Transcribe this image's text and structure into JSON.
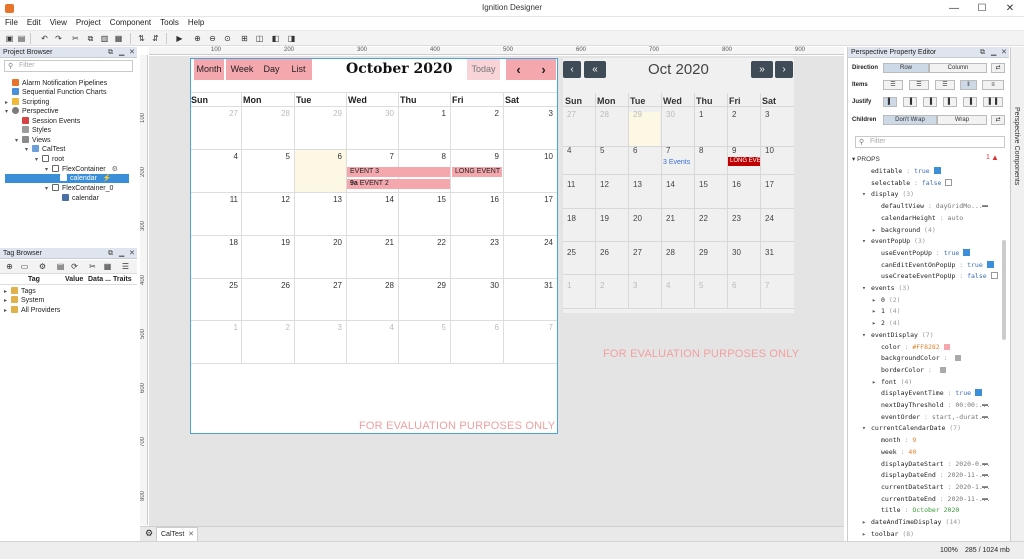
{
  "window": {
    "title": "Ignition Designer",
    "minimize": "—",
    "maximize": "☐",
    "close": "✕"
  },
  "menu": [
    "File",
    "Edit",
    "View",
    "Project",
    "Component",
    "Tools",
    "Help"
  ],
  "project_browser": {
    "title": "Project Browser",
    "filter_placeholder": "Filter",
    "items": [
      "Alarm Notification Pipelines",
      "Sequential Function Charts",
      "Scripting",
      "Perspective",
      "Session Events",
      "Styles",
      "Views",
      "CalTest",
      "root",
      "FlexContainer",
      "calendar",
      "FlexContainer_0",
      "calendar"
    ]
  },
  "tag_browser": {
    "title": "Tag Browser",
    "columns": [
      "Tag",
      "Value",
      "Data ...",
      "Traits"
    ],
    "items": [
      "Tags",
      "System",
      "All Providers"
    ]
  },
  "calendar1": {
    "buttons": {
      "month": "Month",
      "week": "Week",
      "day": "Day",
      "list": "List",
      "today": "Today",
      "prev": "‹",
      "next": "›"
    },
    "title": "October 2020",
    "days": [
      "Sun",
      "Mon",
      "Tue",
      "Wed",
      "Thu",
      "Fri",
      "Sat"
    ],
    "weeks": [
      [
        "27",
        "28",
        "29",
        "30",
        "1",
        "2",
        "3"
      ],
      [
        "4",
        "5",
        "6",
        "7",
        "8",
        "9",
        "10"
      ],
      [
        "11",
        "12",
        "13",
        "14",
        "15",
        "16",
        "17"
      ],
      [
        "18",
        "19",
        "20",
        "21",
        "22",
        "23",
        "24"
      ],
      [
        "25",
        "26",
        "27",
        "28",
        "29",
        "30",
        "31"
      ],
      [
        "1",
        "2",
        "3",
        "4",
        "5",
        "6",
        "7"
      ]
    ],
    "events": {
      "e3": "EVENT 3",
      "e2_time": "9a",
      "e2": "EVENT 2",
      "long": "LONG EVENT N"
    },
    "watermark": "FOR EVALUATION PURPOSES ONLY"
  },
  "calendar2": {
    "title": "Oct 2020",
    "buttons": {
      "prev_year": "‹",
      "prev": "«",
      "next": "»",
      "next_year": "›"
    },
    "days": [
      "Sun",
      "Mon",
      "Tue",
      "Wed",
      "Thu",
      "Fri",
      "Sat"
    ],
    "weeks": [
      [
        "27",
        "28",
        "29",
        "30",
        "1",
        "2",
        "3"
      ],
      [
        "4",
        "5",
        "6",
        "7",
        "8",
        "9",
        "10"
      ],
      [
        "11",
        "12",
        "13",
        "14",
        "15",
        "16",
        "17"
      ],
      [
        "18",
        "19",
        "20",
        "21",
        "22",
        "23",
        "24"
      ],
      [
        "25",
        "26",
        "27",
        "28",
        "29",
        "30",
        "31"
      ],
      [
        "1",
        "2",
        "3",
        "4",
        "5",
        "6",
        "7"
      ]
    ],
    "events_link": "3 Events",
    "long_event": "LONG EVEN",
    "watermark": "FOR EVALUATION PURPOSES ONLY"
  },
  "tab": {
    "label": "CalTest"
  },
  "status": {
    "zoom": "100%",
    "memory": "285 / 1024 mb"
  },
  "property_editor": {
    "title": "Perspective Property Editor",
    "side_tab": "Perspective Components",
    "labels": {
      "direction": "Direction",
      "items": "Items",
      "justify": "Justify",
      "children": "Children"
    },
    "direction": [
      "Row",
      "Column"
    ],
    "children": [
      "Don't Wrap",
      "Wrap"
    ],
    "filter_placeholder": "Filter",
    "props_header": "PROPS",
    "warning_count": "1",
    "rows": [
      {
        "k": "editable",
        "v": "true"
      },
      {
        "k": "selectable",
        "v": "false"
      },
      {
        "k": "display",
        "c": "(3)"
      },
      {
        "k": "defaultView",
        "v": "dayGridMo..."
      },
      {
        "k": "calendarHeight",
        "v": "auto"
      },
      {
        "k": "background",
        "c": "(4)"
      },
      {
        "k": "eventPopUp",
        "c": "(3)"
      },
      {
        "k": "useEventPopUp",
        "v": "true"
      },
      {
        "k": "canEditEventOnPopUp",
        "v": "true"
      },
      {
        "k": "useCreateEventPopUp",
        "v": "false"
      },
      {
        "k": "events",
        "c": "(3)"
      },
      {
        "k": "0",
        "c": "(2)"
      },
      {
        "k": "1",
        "c": "(4)"
      },
      {
        "k": "2",
        "c": "(4)"
      },
      {
        "k": "eventDisplay",
        "c": "(7)"
      },
      {
        "k": "color",
        "v": "#FF8282"
      },
      {
        "k": "backgroundColor",
        "v": ""
      },
      {
        "k": "borderColor",
        "v": ""
      },
      {
        "k": "font",
        "c": "(4)"
      },
      {
        "k": "displayEventTime",
        "v": "true"
      },
      {
        "k": "nextDayThreshold",
        "v": "00:00:..."
      },
      {
        "k": "eventOrder",
        "v": "start,-durat..."
      },
      {
        "k": "currentCalendarDate",
        "c": "(7)"
      },
      {
        "k": "month",
        "v": "9"
      },
      {
        "k": "week",
        "v": "40"
      },
      {
        "k": "displayDateStart",
        "v": "2020-0..."
      },
      {
        "k": "displayDateEnd",
        "v": "2020-11-..."
      },
      {
        "k": "currentDateStart",
        "v": "2020-1..."
      },
      {
        "k": "currentDateEnd",
        "v": "2020-11-..."
      },
      {
        "k": "title",
        "v": "October 2020"
      },
      {
        "k": "dateAndTimeDisplay",
        "c": "(14)"
      },
      {
        "k": "toolbar",
        "c": "(8)"
      }
    ]
  },
  "colors": {
    "accent_pink": "#f4a7ad",
    "event_red": "#c00000",
    "selection_blue": "#3b8fd9",
    "today_yellow": "#fcf8e3"
  }
}
